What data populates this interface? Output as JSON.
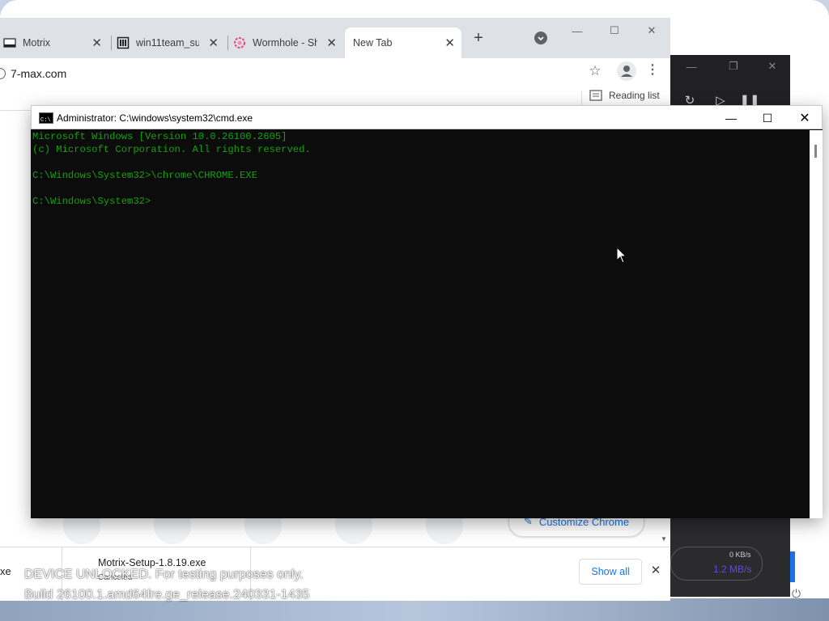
{
  "browser": {
    "tabs": [
      {
        "label": "Motrix",
        "icon": "motrix-icon"
      },
      {
        "label": "win11team_su",
        "icon": "repo-icon"
      },
      {
        "label": "Wormhole - Sh",
        "icon": "wormhole-icon"
      },
      {
        "label": "New Tab",
        "icon": "none",
        "active": true
      }
    ],
    "address": "7-max.com",
    "reading_list": "Reading list",
    "customize_label": "Customize Chrome",
    "downloads": {
      "left_fragment": "xe",
      "file_name": "Motrix-Setup-1.8.19.exe",
      "status": "Canceled",
      "show_all": "Show all"
    }
  },
  "motrix": {
    "down_speed": "0 KB/s",
    "up_speed": "1.2 MB/s"
  },
  "cmd": {
    "title": "Administrator: C:\\windows\\system32\\cmd.exe",
    "lines": [
      "Microsoft Windows [Version 10.0.26100.2605]",
      "(c) Microsoft Corporation. All rights reserved.",
      "",
      "C:\\Windows\\System32>\\chrome\\CHROME.EXE",
      "",
      "C:\\Windows\\System32>"
    ]
  },
  "watermark": {
    "line1": "DEVICE UNLOCKED. For testing purposes only.",
    "line2": "Build 26100.1.amd64fre.ge_release.240331-1435"
  },
  "colors": {
    "terminal_text": "#13a10e",
    "terminal_bg": "#0c0c0c",
    "chrome_accent": "#1a73e8"
  }
}
